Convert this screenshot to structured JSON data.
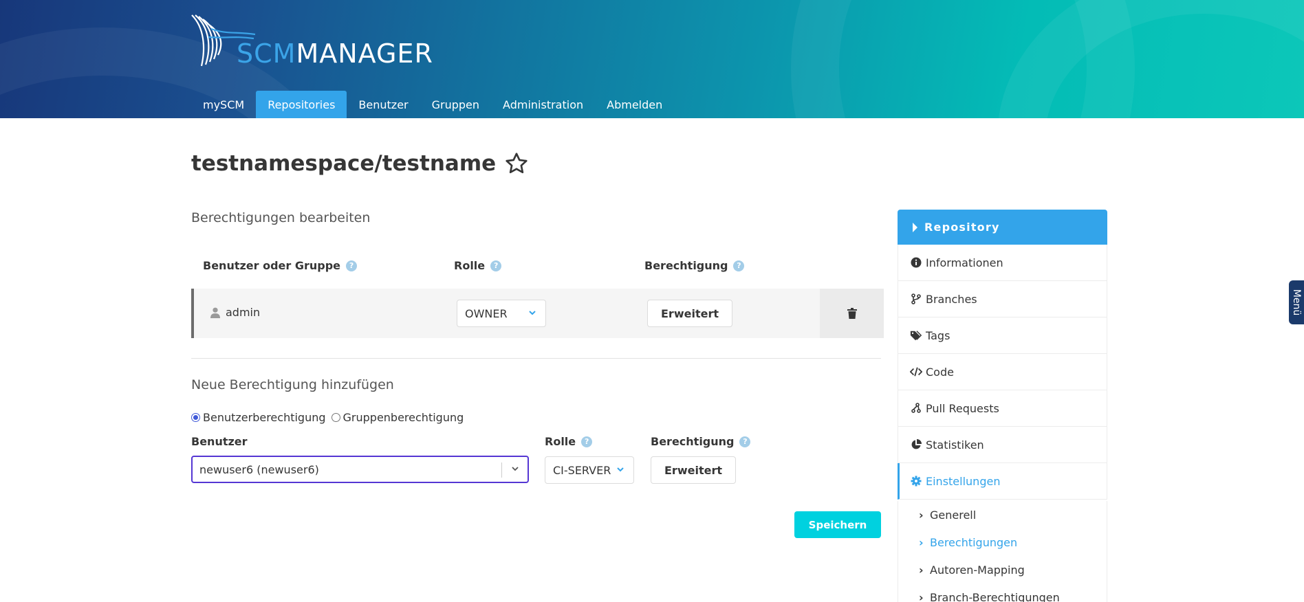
{
  "header": {
    "logo": {
      "prefix": "SCM",
      "suffix": "MANAGER"
    },
    "nav": [
      {
        "label": "mySCM",
        "active": false
      },
      {
        "label": "Repositories",
        "active": true
      },
      {
        "label": "Benutzer",
        "active": false
      },
      {
        "label": "Gruppen",
        "active": false
      },
      {
        "label": "Administration",
        "active": false
      },
      {
        "label": "Abmelden",
        "active": false
      }
    ]
  },
  "page": {
    "title": "testnamespace/testname"
  },
  "edit_section": {
    "title": "Berechtigungen bearbeiten",
    "columns": {
      "user_or_group": "Benutzer oder Gruppe",
      "role": "Rolle",
      "permission": "Berechtigung"
    },
    "row": {
      "name": "admin",
      "role": "OWNER",
      "advanced_label": "Erweitert"
    }
  },
  "add_section": {
    "title": "Neue Berechtigung hinzufügen",
    "radio_user": "Benutzerberechtigung",
    "radio_group": "Gruppenberechtigung",
    "user_label": "Benutzer",
    "role_label": "Rolle",
    "permission_label": "Berechtigung",
    "user_value": "newuser6 (newuser6)",
    "role_value": "CI-SERVER",
    "advanced_label": "Erweitert",
    "save_label": "Speichern"
  },
  "sidebar": {
    "header": "Repository",
    "items": [
      {
        "label": "Informationen",
        "icon": "info-icon"
      },
      {
        "label": "Branches",
        "icon": "branch-icon"
      },
      {
        "label": "Tags",
        "icon": "tags-icon"
      },
      {
        "label": "Code",
        "icon": "code-icon"
      },
      {
        "label": "Pull Requests",
        "icon": "pull-request-icon"
      },
      {
        "label": "Statistiken",
        "icon": "pie-chart-icon"
      },
      {
        "label": "Einstellungen",
        "icon": "gear-icon",
        "active": true
      }
    ],
    "subitems": [
      {
        "label": "Generell"
      },
      {
        "label": "Berechtigungen",
        "active": true
      },
      {
        "label": "Autoren-Mapping"
      },
      {
        "label": "Branch-Berechtigungen"
      }
    ]
  },
  "menu_tab": "Menü",
  "colors": {
    "primary": "#33a4ea",
    "save": "#00d1df",
    "focus": "#5536d3"
  }
}
